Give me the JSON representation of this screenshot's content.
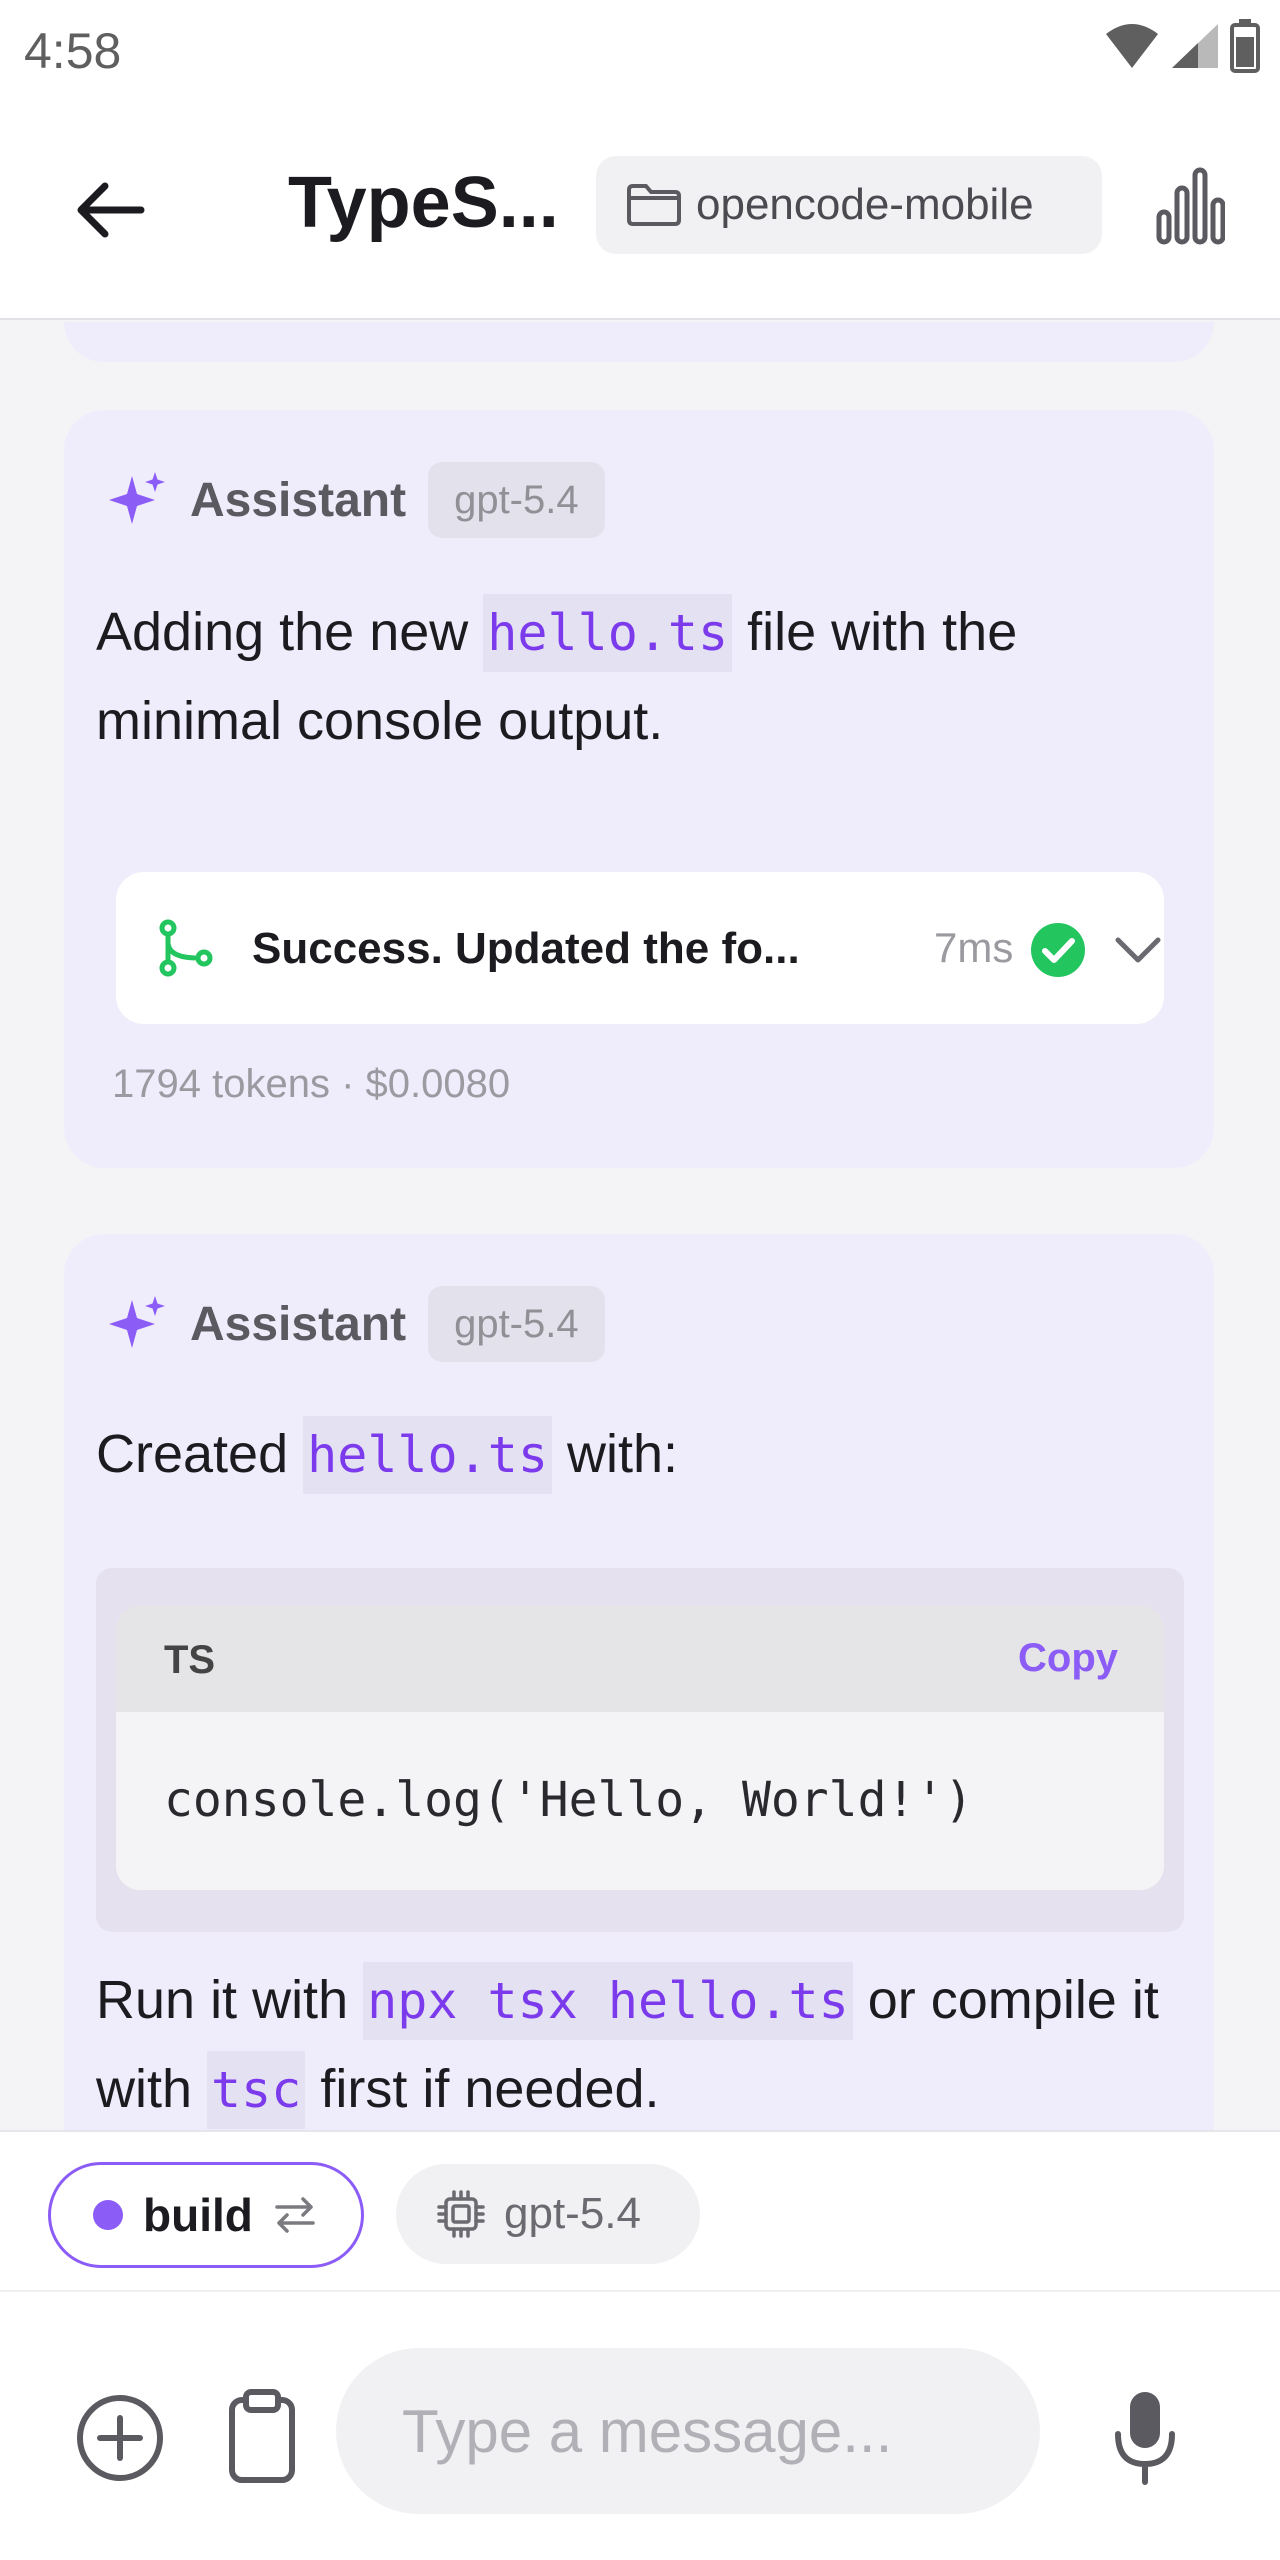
{
  "status_bar": {
    "time": "4:58"
  },
  "header": {
    "title": "TypeS...",
    "project": "opencode-mobile"
  },
  "messages": [
    {
      "role": "Assistant",
      "model": "gpt-5.4",
      "text_before": "Adding the new ",
      "code": "hello.ts",
      "text_after": " file with the minimal console output.",
      "tool": {
        "summary": "Success. Updated the fo...",
        "duration": "7ms"
      },
      "usage": "1794 tokens · $0.0080"
    },
    {
      "role": "Assistant",
      "model": "gpt-5.4",
      "text1_before": "Created ",
      "text1_code": "hello.ts",
      "text1_after": " with:",
      "code_block": {
        "language": "TS",
        "copy_label": "Copy",
        "code": "console.log('Hello, World!')"
      },
      "text2_before": "Run it with ",
      "text2_code1": "npx tsx hello.ts",
      "text2_mid": " or compile it with ",
      "text2_code2": "tsc",
      "text2_after": " first if needed."
    }
  ],
  "composer": {
    "agent": "build",
    "model": "gpt-5.4",
    "placeholder": "Type a message..."
  },
  "colors": {
    "accent": "#8b5cf6",
    "success": "#22c55e",
    "card_bg": "#efedfb"
  }
}
